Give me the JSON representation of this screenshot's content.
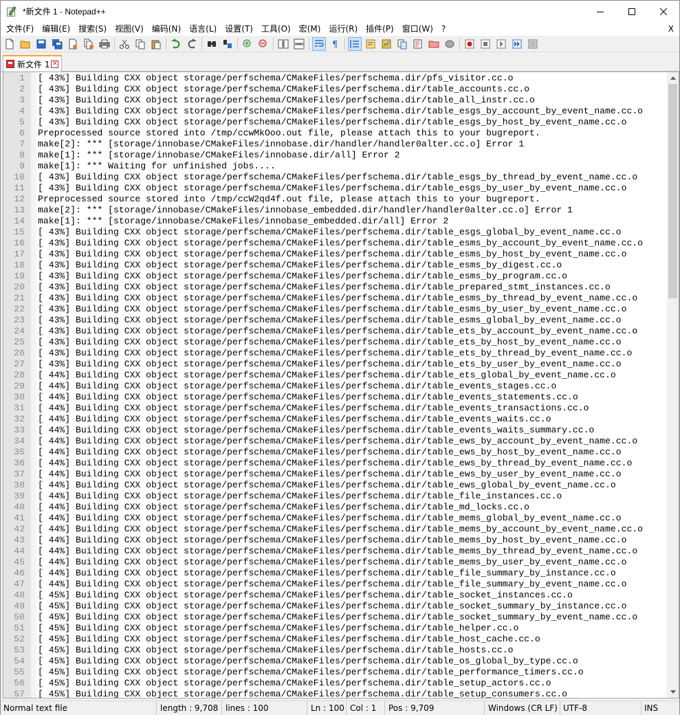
{
  "window": {
    "title": "*新文件 1 - Notepad++"
  },
  "menu": [
    "文件(F)",
    "编辑(E)",
    "搜索(S)",
    "视图(V)",
    "编码(N)",
    "语言(L)",
    "设置(T)",
    "工具(O)",
    "宏(M)",
    "运行(R)",
    "插件(P)",
    "窗口(W)",
    "?"
  ],
  "menu_close": "X",
  "toolbar": {
    "icons": [
      "new-file-icon",
      "open-file-icon",
      "save-icon",
      "save-all-icon",
      "close-icon",
      "close-all-icon",
      "print-icon",
      "cut-icon",
      "copy-icon",
      "paste-icon",
      "undo-icon",
      "redo-icon",
      "find-icon",
      "replace-icon",
      "zoom-in-icon",
      "zoom-out-icon",
      "sync-vertical-icon",
      "sync-horizontal-icon",
      "word-wrap-icon",
      "show-all-chars-icon",
      "indent-guide-icon",
      "user-language-icon",
      "doc-map-icon",
      "document-list-icon",
      "function-list-icon",
      "folder-workspace-icon",
      "monitoring-icon",
      "record-macro-icon",
      "stop-record-icon",
      "play-macro-icon",
      "run-macro-multiple-icon",
      "save-macro-icon"
    ]
  },
  "tab": {
    "label": "新文件 1",
    "close": "✕"
  },
  "editor": {
    "lines": [
      "[ 43%] Building CXX object storage/perfschema/CMakeFiles/perfschema.dir/pfs_visitor.cc.o",
      "[ 43%] Building CXX object storage/perfschema/CMakeFiles/perfschema.dir/table_accounts.cc.o",
      "[ 43%] Building CXX object storage/perfschema/CMakeFiles/perfschema.dir/table_all_instr.cc.o",
      "[ 43%] Building CXX object storage/perfschema/CMakeFiles/perfschema.dir/table_esgs_by_account_by_event_name.cc.o",
      "[ 43%] Building CXX object storage/perfschema/CMakeFiles/perfschema.dir/table_esgs_by_host_by_event_name.cc.o",
      "Preprocessed source stored into /tmp/ccwMkOoo.out file, please attach this to your bugreport.",
      "make[2]: *** [storage/innobase/CMakeFiles/innobase.dir/handler/handler0alter.cc.o] Error 1",
      "make[1]: *** [storage/innobase/CMakeFiles/innobase.dir/all] Error 2",
      "make[1]: *** Waiting for unfinished jobs....",
      "[ 43%] Building CXX object storage/perfschema/CMakeFiles/perfschema.dir/table_esgs_by_thread_by_event_name.cc.o",
      "[ 43%] Building CXX object storage/perfschema/CMakeFiles/perfschema.dir/table_esgs_by_user_by_event_name.cc.o",
      "Preprocessed source stored into /tmp/ccW2qd4f.out file, please attach this to your bugreport.",
      "make[2]: *** [storage/innobase/CMakeFiles/innobase_embedded.dir/handler/handler0alter.cc.o] Error 1",
      "make[1]: *** [storage/innobase/CMakeFiles/innobase_embedded.dir/all] Error 2",
      "[ 43%] Building CXX object storage/perfschema/CMakeFiles/perfschema.dir/table_esgs_global_by_event_name.cc.o",
      "[ 43%] Building CXX object storage/perfschema/CMakeFiles/perfschema.dir/table_esms_by_account_by_event_name.cc.o",
      "[ 43%] Building CXX object storage/perfschema/CMakeFiles/perfschema.dir/table_esms_by_host_by_event_name.cc.o",
      "[ 43%] Building CXX object storage/perfschema/CMakeFiles/perfschema.dir/table_esms_by_digest.cc.o",
      "[ 43%] Building CXX object storage/perfschema/CMakeFiles/perfschema.dir/table_esms_by_program.cc.o",
      "[ 43%] Building CXX object storage/perfschema/CMakeFiles/perfschema.dir/table_prepared_stmt_instances.cc.o",
      "[ 43%] Building CXX object storage/perfschema/CMakeFiles/perfschema.dir/table_esms_by_thread_by_event_name.cc.o",
      "[ 43%] Building CXX object storage/perfschema/CMakeFiles/perfschema.dir/table_esms_by_user_by_event_name.cc.o",
      "[ 43%] Building CXX object storage/perfschema/CMakeFiles/perfschema.dir/table_esms_global_by_event_name.cc.o",
      "[ 43%] Building CXX object storage/perfschema/CMakeFiles/perfschema.dir/table_ets_by_account_by_event_name.cc.o",
      "[ 43%] Building CXX object storage/perfschema/CMakeFiles/perfschema.dir/table_ets_by_host_by_event_name.cc.o",
      "[ 43%] Building CXX object storage/perfschema/CMakeFiles/perfschema.dir/table_ets_by_thread_by_event_name.cc.o",
      "[ 43%] Building CXX object storage/perfschema/CMakeFiles/perfschema.dir/table_ets_by_user_by_event_name.cc.o",
      "[ 44%] Building CXX object storage/perfschema/CMakeFiles/perfschema.dir/table_ets_global_by_event_name.cc.o",
      "[ 44%] Building CXX object storage/perfschema/CMakeFiles/perfschema.dir/table_events_stages.cc.o",
      "[ 44%] Building CXX object storage/perfschema/CMakeFiles/perfschema.dir/table_events_statements.cc.o",
      "[ 44%] Building CXX object storage/perfschema/CMakeFiles/perfschema.dir/table_events_transactions.cc.o",
      "[ 44%] Building CXX object storage/perfschema/CMakeFiles/perfschema.dir/table_events_waits.cc.o",
      "[ 44%] Building CXX object storage/perfschema/CMakeFiles/perfschema.dir/table_events_waits_summary.cc.o",
      "[ 44%] Building CXX object storage/perfschema/CMakeFiles/perfschema.dir/table_ews_by_account_by_event_name.cc.o",
      "[ 44%] Building CXX object storage/perfschema/CMakeFiles/perfschema.dir/table_ews_by_host_by_event_name.cc.o",
      "[ 44%] Building CXX object storage/perfschema/CMakeFiles/perfschema.dir/table_ews_by_thread_by_event_name.cc.o",
      "[ 44%] Building CXX object storage/perfschema/CMakeFiles/perfschema.dir/table_ews_by_user_by_event_name.cc.o",
      "[ 44%] Building CXX object storage/perfschema/CMakeFiles/perfschema.dir/table_ews_global_by_event_name.cc.o",
      "[ 44%] Building CXX object storage/perfschema/CMakeFiles/perfschema.dir/table_file_instances.cc.o",
      "[ 44%] Building CXX object storage/perfschema/CMakeFiles/perfschema.dir/table_md_locks.cc.o",
      "[ 44%] Building CXX object storage/perfschema/CMakeFiles/perfschema.dir/table_mems_global_by_event_name.cc.o",
      "[ 44%] Building CXX object storage/perfschema/CMakeFiles/perfschema.dir/table_mems_by_account_by_event_name.cc.o",
      "[ 44%] Building CXX object storage/perfschema/CMakeFiles/perfschema.dir/table_mems_by_host_by_event_name.cc.o",
      "[ 44%] Building CXX object storage/perfschema/CMakeFiles/perfschema.dir/table_mems_by_thread_by_event_name.cc.o",
      "[ 44%] Building CXX object storage/perfschema/CMakeFiles/perfschema.dir/table_mems_by_user_by_event_name.cc.o",
      "[ 44%] Building CXX object storage/perfschema/CMakeFiles/perfschema.dir/table_file_summary_by_instance.cc.o",
      "[ 44%] Building CXX object storage/perfschema/CMakeFiles/perfschema.dir/table_file_summary_by_event_name.cc.o",
      "[ 45%] Building CXX object storage/perfschema/CMakeFiles/perfschema.dir/table_socket_instances.cc.o",
      "[ 45%] Building CXX object storage/perfschema/CMakeFiles/perfschema.dir/table_socket_summary_by_instance.cc.o",
      "[ 45%] Building CXX object storage/perfschema/CMakeFiles/perfschema.dir/table_socket_summary_by_event_name.cc.o",
      "[ 45%] Building CXX object storage/perfschema/CMakeFiles/perfschema.dir/table_helper.cc.o",
      "[ 45%] Building CXX object storage/perfschema/CMakeFiles/perfschema.dir/table_host_cache.cc.o",
      "[ 45%] Building CXX object storage/perfschema/CMakeFiles/perfschema.dir/table_hosts.cc.o",
      "[ 45%] Building CXX object storage/perfschema/CMakeFiles/perfschema.dir/table_os_global_by_type.cc.o",
      "[ 45%] Building CXX object storage/perfschema/CMakeFiles/perfschema.dir/table_performance_timers.cc.o",
      "[ 45%] Building CXX object storage/perfschema/CMakeFiles/perfschema.dir/table_setup_actors.cc.o",
      "[ 45%] Building CXX object storage/perfschema/CMakeFiles/perfschema.dir/table_setup_consumers.cc.o"
    ]
  },
  "statusbar": {
    "file_type": "Normal text file",
    "length": "length : 9,708",
    "lines": "lines : 100",
    "ln": "Ln : 100",
    "col": "Col : 1",
    "pos": "Pos : 9,709",
    "eol": "Windows (CR LF)",
    "encoding": "UTF-8",
    "mode": "INS"
  }
}
